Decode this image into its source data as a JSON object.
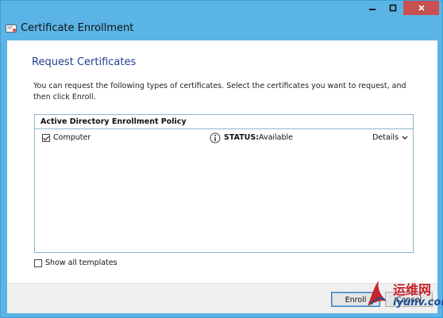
{
  "window": {
    "title": "Certificate Enrollment",
    "controls": {
      "minimize": "minimize",
      "maximize": "maximize",
      "close": "close"
    }
  },
  "page": {
    "heading": "Request Certificates",
    "description": "You can request the following types of certificates. Select the certificates you want to request, and then click Enroll."
  },
  "policy": {
    "header": "Active Directory Enrollment Policy",
    "certificates": [
      {
        "name": "Computer",
        "checked": true,
        "status_label": "STATUS:",
        "status_value": "Available",
        "details_label": "Details"
      }
    ]
  },
  "options": {
    "show_all_label": "Show all templates",
    "show_all_checked": false
  },
  "buttons": {
    "enroll": "Enroll",
    "cancel": "Cancel"
  },
  "watermark": {
    "cn_text": "运维网",
    "en_text": "iyunv.com"
  },
  "colors": {
    "frame": "#5ab4e5",
    "heading": "#1f3e8c",
    "close": "#c75050"
  }
}
